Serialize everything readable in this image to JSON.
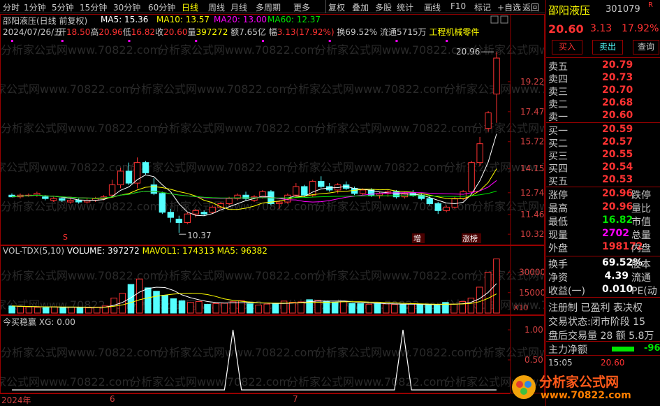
{
  "toolbar": {
    "tabs": [
      "分时",
      "1分钟",
      "5分钟",
      "15分钟",
      "30分钟",
      "60分钟",
      "日线",
      "周线",
      "月线",
      "多周期",
      "更多"
    ],
    "active": "日线",
    "right_tabs": [
      "复权",
      "叠加",
      "多股",
      "统计",
      "画线",
      "F10",
      "标记",
      "+自选",
      "返回"
    ]
  },
  "chart_header": {
    "title": "邵阳液压(日线 前复权)",
    "ma5": "MA5: 15.36",
    "ma10": "MA10: 13.57",
    "ma20": "MA20: 13.00",
    "ma60": "MA60: 12.37",
    "date": "2024/07/26/五",
    "open_label": "开",
    "open": "18.50",
    "high_label": "高",
    "high": "20.96",
    "low_label": "低",
    "low": "16.82",
    "close_label": "收",
    "close": "20.60",
    "vol_label": "量",
    "vol": "397272",
    "amount_label": "额",
    "amount": "7.65亿",
    "range_label": "幅",
    "range": "3.13(17.92%)",
    "turnover": "换69.52%",
    "float": "流通5715万",
    "industry": "工程机械零件"
  },
  "price_axis": [
    "19.22",
    "17.47",
    "15.72",
    "14.15",
    "12.74",
    "11.46",
    "10.32"
  ],
  "annotations": {
    "high_mark": "20.96",
    "low_mark": "10.37",
    "tag_zeng": "增",
    "tag_zhangbang": "涨榜",
    "tag_s": "S"
  },
  "vol_header": {
    "name": "VOL-TDX(5,10)",
    "volume": "VOLUME: 397272",
    "mavol1": "MAVOL1: 174313",
    "ma5": "MA5: 96382"
  },
  "vol_axis": [
    "30000",
    "15000"
  ],
  "vol_unit": "X10",
  "ind_header": {
    "name": "今买稳赢",
    "xg": "XG: 0.00"
  },
  "ind_axis": [
    "1.00",
    "0.50"
  ],
  "time_axis": [
    "2024年",
    "6",
    "7"
  ],
  "quote": {
    "name": "邵阳液压",
    "code": "301079",
    "badge": "R",
    "price": "20.60",
    "change": "3.13",
    "pct": "17.92%",
    "buy_btn": "买入",
    "sell_btn": "卖出",
    "query_btn": "查询",
    "asks": [
      {
        "label": "卖五",
        "price": "20.79"
      },
      {
        "label": "卖四",
        "price": "20.73"
      },
      {
        "label": "卖三",
        "price": "20.70"
      },
      {
        "label": "卖二",
        "price": "20.68"
      },
      {
        "label": "卖一",
        "price": "20.60"
      }
    ],
    "bids": [
      {
        "label": "买一",
        "price": "20.59"
      },
      {
        "label": "买二",
        "price": "20.57"
      },
      {
        "label": "买三",
        "price": "20.55"
      },
      {
        "label": "买四",
        "price": "20.54"
      },
      {
        "label": "买五",
        "price": "20.53"
      }
    ],
    "stats": [
      {
        "label": "涨停",
        "value": "20.96",
        "suffix": "跌停"
      },
      {
        "label": "最高",
        "value": "20.96",
        "suffix": "量比"
      },
      {
        "label": "最低",
        "value": "16.82",
        "suffix": "市值"
      },
      {
        "label": "现量",
        "value": "2702",
        "suffix": "总量"
      },
      {
        "label": "外盘",
        "value": "198172",
        "suffix": "内盘"
      }
    ],
    "stats2": [
      {
        "label": "换手",
        "value": "69.52%",
        "suffix": "股本"
      },
      {
        "label": "净资",
        "value": "4.39",
        "suffix": "流通"
      },
      {
        "label": "收益(一)",
        "value": "0.010",
        "suffix": "PE(动"
      }
    ],
    "extra": [
      "注册制 已盈利 表决权",
      "交易状态:闭市阶段 15",
      "盘后交易量 28 额 5.8万"
    ],
    "main_flow_label": "主力净额",
    "main_flow_value": "-96",
    "tick_time": "15:05",
    "tick_price": "20.60"
  },
  "watermark": "分析家公式网www.70822.com",
  "logo": {
    "text": "分析家公式网",
    "url": "www.70822.com"
  },
  "chart_data": [
    {
      "type": "candlestick",
      "title": "邵阳液压(日线 前复权)",
      "ylim": [
        10.0,
        21.5
      ],
      "candles": [
        [
          12.6,
          12.7,
          12.5,
          12.5
        ],
        [
          12.5,
          12.7,
          12.4,
          12.6
        ],
        [
          12.6,
          12.7,
          12.5,
          12.6
        ],
        [
          12.6,
          12.8,
          12.5,
          12.7
        ],
        [
          12.5,
          12.6,
          12.3,
          12.4
        ],
        [
          12.3,
          12.5,
          12.2,
          12.4
        ],
        [
          12.4,
          12.5,
          12.2,
          12.3
        ],
        [
          12.2,
          12.4,
          12.1,
          12.3
        ],
        [
          12.3,
          12.4,
          12.1,
          12.2
        ],
        [
          12.2,
          12.4,
          12.1,
          12.3
        ],
        [
          12.3,
          12.5,
          12.2,
          12.4
        ],
        [
          12.4,
          12.6,
          12.3,
          12.5
        ],
        [
          12.6,
          13.5,
          12.5,
          13.2
        ],
        [
          13.2,
          14.2,
          13.0,
          14.0
        ],
        [
          14.0,
          14.5,
          13.2,
          13.3
        ],
        [
          13.3,
          14.8,
          13.0,
          14.5
        ],
        [
          14.5,
          14.6,
          13.8,
          13.9
        ],
        [
          13.2,
          13.6,
          12.6,
          12.7
        ],
        [
          12.7,
          12.8,
          11.5,
          11.6
        ],
        [
          11.6,
          11.8,
          11.0,
          11.3
        ],
        [
          11.2,
          11.4,
          10.4,
          11.0
        ],
        [
          11.0,
          11.6,
          10.9,
          11.5
        ],
        [
          11.5,
          11.8,
          11.3,
          11.7
        ],
        [
          11.6,
          11.7,
          11.4,
          11.5
        ],
        [
          11.6,
          12.0,
          11.5,
          11.9
        ],
        [
          11.9,
          12.2,
          11.8,
          12.1
        ],
        [
          12.1,
          12.5,
          12.0,
          12.4
        ],
        [
          12.4,
          12.7,
          12.3,
          12.6
        ],
        [
          12.6,
          12.8,
          12.3,
          12.4
        ],
        [
          12.3,
          12.6,
          12.2,
          12.5
        ],
        [
          12.5,
          12.9,
          12.4,
          12.8
        ],
        [
          12.8,
          12.9,
          12.0,
          12.1
        ],
        [
          12.1,
          12.3,
          11.8,
          12.2
        ],
        [
          12.2,
          12.7,
          12.1,
          12.6
        ],
        [
          12.6,
          13.3,
          12.5,
          13.1
        ],
        [
          13.1,
          13.2,
          12.5,
          12.6
        ],
        [
          12.6,
          13.5,
          12.5,
          13.4
        ],
        [
          13.4,
          13.7,
          13.0,
          13.1
        ],
        [
          13.1,
          13.3,
          12.8,
          12.9
        ],
        [
          12.9,
          13.3,
          12.7,
          13.2
        ],
        [
          13.2,
          13.4,
          12.9,
          13.0
        ],
        [
          13.0,
          13.1,
          12.6,
          12.7
        ],
        [
          12.7,
          13.0,
          12.6,
          12.9
        ],
        [
          12.9,
          13.0,
          12.5,
          12.6
        ],
        [
          12.6,
          12.8,
          12.4,
          12.7
        ],
        [
          12.7,
          12.9,
          12.5,
          12.8
        ],
        [
          12.8,
          12.9,
          12.4,
          12.5
        ],
        [
          12.5,
          12.8,
          12.4,
          12.7
        ],
        [
          12.7,
          12.9,
          12.5,
          12.6
        ],
        [
          12.6,
          12.7,
          12.3,
          12.4
        ],
        [
          12.4,
          12.6,
          12.0,
          12.1
        ],
        [
          12.1,
          12.2,
          11.5,
          11.7
        ],
        [
          11.7,
          12.0,
          11.6,
          11.9
        ],
        [
          11.9,
          12.5,
          11.8,
          12.4
        ],
        [
          12.4,
          12.9,
          12.3,
          12.8
        ],
        [
          12.8,
          14.6,
          12.7,
          14.5
        ],
        [
          14.5,
          16.0,
          14.3,
          15.6
        ],
        [
          16.5,
          17.5,
          16.3,
          17.4
        ],
        [
          18.5,
          20.96,
          16.82,
          20.6
        ]
      ]
    },
    {
      "type": "bar",
      "title": "VOL-TDX(5,10)",
      "ylim": [
        0,
        40000
      ],
      "values": [
        5200,
        4800,
        4500,
        4200,
        4000,
        4600,
        3900,
        4300,
        4100,
        3800,
        4400,
        5200,
        11000,
        14500,
        21000,
        25000,
        18500,
        16000,
        13000,
        10500,
        9000,
        7800,
        8500,
        6400,
        7000,
        7200,
        8300,
        9100,
        6800,
        5900,
        6600,
        7100,
        8800,
        7900,
        8200,
        9800,
        9400,
        8600,
        7900,
        8400,
        7100,
        6900,
        6500,
        7200,
        6700,
        6300,
        6100,
        6800,
        6400,
        5900,
        5600,
        7800,
        6600,
        8500,
        11000,
        19000,
        30000,
        39727
      ]
    },
    {
      "type": "line",
      "title": "今买稳赢",
      "ylim": [
        0,
        1
      ],
      "values": [
        0,
        0,
        0,
        0,
        0,
        0,
        0,
        0,
        0,
        0,
        0,
        0,
        0,
        0,
        0,
        0,
        0,
        0,
        0,
        0,
        0,
        0,
        0,
        0,
        0,
        0,
        1,
        0,
        0,
        0,
        0,
        0,
        0,
        0,
        0,
        0,
        0,
        0,
        0,
        0,
        0,
        0,
        0,
        0,
        0,
        0,
        1,
        0,
        0,
        0,
        0,
        0,
        0,
        0,
        0,
        0,
        0,
        0
      ]
    }
  ]
}
